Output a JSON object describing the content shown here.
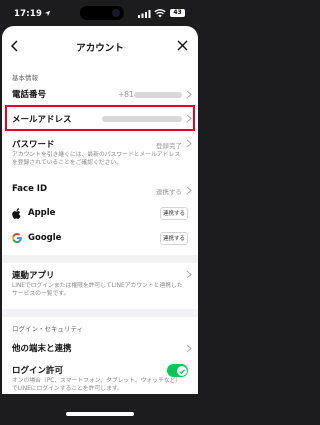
{
  "status_bar": {
    "time": "17:19",
    "battery": "43"
  },
  "header": {
    "title": "アカウント"
  },
  "sections": {
    "basic_info": "基本情報",
    "login_security": "ログイン・セキュリティ"
  },
  "rows": {
    "phone": {
      "title": "電話番号",
      "value_prefix": "+81"
    },
    "email": {
      "title": "メールアドレス"
    },
    "password": {
      "title": "パスワード",
      "status": "登録完了",
      "description": "アカウントを引き継ぐには、最新のパスワードとメールアドレスを登録されていることをご確認ください。"
    },
    "face_id": {
      "title": "Face ID",
      "status": "連携する"
    },
    "apple": {
      "title": "Apple",
      "button": "連携する"
    },
    "google": {
      "title": "Google",
      "button": "連携する"
    },
    "linked_apps": {
      "title": "連動アプリ",
      "description": "LINEでログインまたは権限を許可してLINEアカウントと連携したサービスの一覧です。"
    },
    "other_devices": {
      "title": "他の端末と連携"
    },
    "login_permission": {
      "title": "ログイン許可",
      "description": "オンの場合（PC、スマートフォン、タブレット、ウォッチなど）でLINEにログインすることを許可します。"
    }
  },
  "colors": {
    "highlight": "#e4002b",
    "toggle_on": "#06c755"
  },
  "icons": [
    "location-arrow-icon",
    "signal-icon",
    "wifi-icon",
    "battery-icon",
    "back-icon",
    "close-icon",
    "chevron-right-icon",
    "apple-icon",
    "google-icon",
    "check-icon"
  ]
}
